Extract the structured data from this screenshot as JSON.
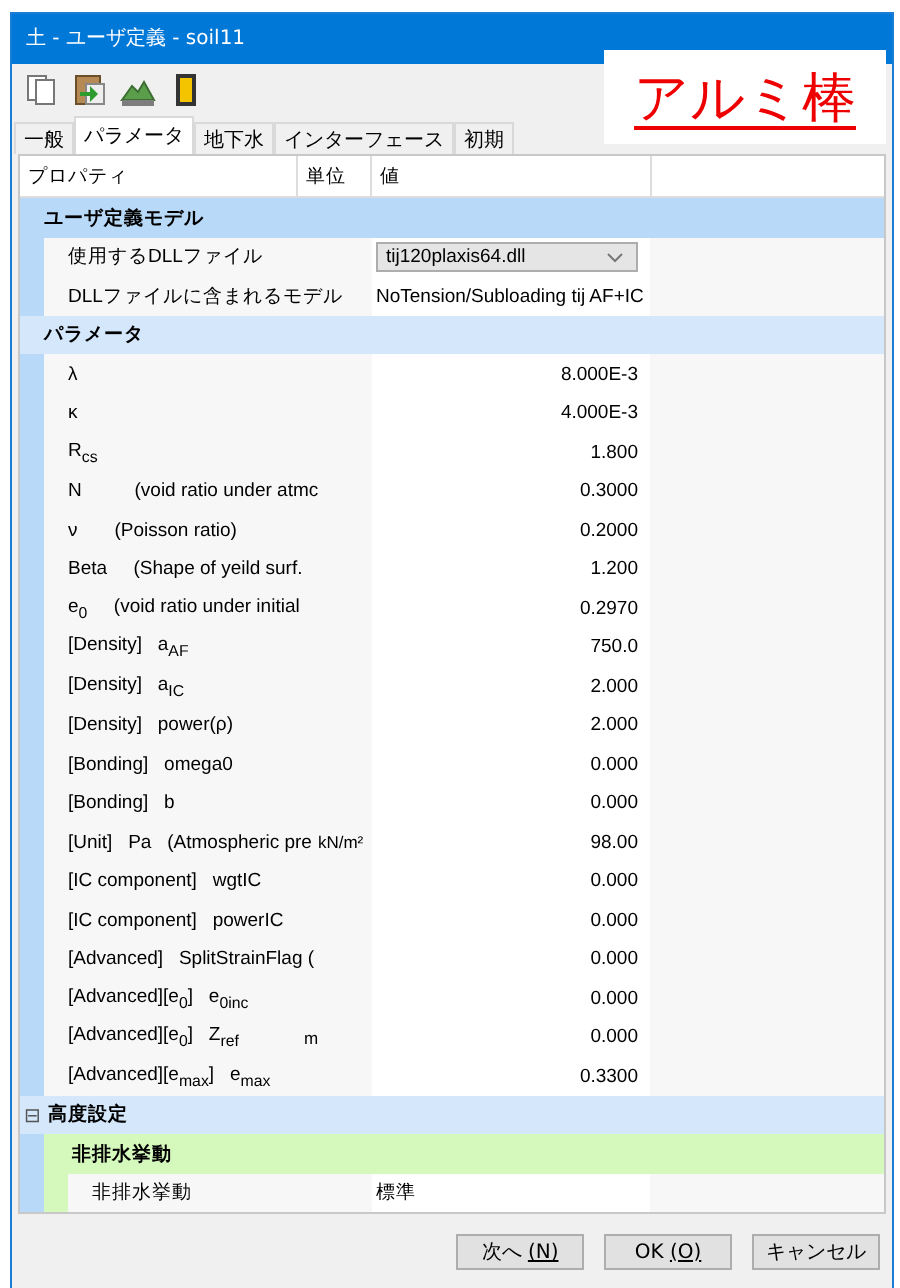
{
  "window": {
    "title": "土 - ユーザ定義 - soil11"
  },
  "annotation": {
    "text": "アルミ棒"
  },
  "tabs": [
    {
      "label": "一般",
      "selected": false
    },
    {
      "label": "パラメータ",
      "selected": true
    },
    {
      "label": "地下水",
      "selected": false
    },
    {
      "label": "インターフェース",
      "selected": false
    },
    {
      "label": "初期",
      "selected": false
    }
  ],
  "grid": {
    "columns": [
      "プロパティ",
      "単位",
      "値"
    ],
    "sections": [
      {
        "title": "ユーザ定義モデル",
        "selected": true,
        "rows": [
          {
            "kind": "dropdown",
            "label": "使用するDLLファイル",
            "value": "tij120plaxis64.dll"
          },
          {
            "kind": "text",
            "label": "DLLファイルに含まれるモデル",
            "value": "NoTension/Subloading tij AF+IC"
          }
        ]
      },
      {
        "title": "パラメータ",
        "selected": false,
        "rows": [
          {
            "kind": "number",
            "label": "λ",
            "value": "8.000E-3"
          },
          {
            "kind": "number",
            "label": "κ",
            "value": "4.000E-3"
          },
          {
            "kind": "number",
            "label": "R$_{cs}$",
            "value": "1.800"
          },
          {
            "kind": "number",
            "label": "N          (void ratio under atmc",
            "value": "0.3000"
          },
          {
            "kind": "number",
            "label": "ν       (Poisson ratio)",
            "value": "0.2000"
          },
          {
            "kind": "number",
            "label": "Beta     (Shape of yeild surf.",
            "value": "1.200"
          },
          {
            "kind": "number",
            "label": "e$_{0}$     (void ratio under initial",
            "value": "0.2970"
          },
          {
            "kind": "number",
            "label": "[Density]   a$_{AF}$",
            "value": "750.0"
          },
          {
            "kind": "number",
            "label": "[Density]   a$_{IC}$",
            "value": "2.000"
          },
          {
            "kind": "number",
            "label": "[Density]   power(ρ)",
            "value": "2.000"
          },
          {
            "kind": "number",
            "label": "[Bonding]   omega0",
            "value": "0.000"
          },
          {
            "kind": "number",
            "label": "[Bonding]   b",
            "value": "0.000"
          },
          {
            "kind": "number",
            "label": "[Unit]   Pa   (Atmospheric pre",
            "unit": "kN/m²",
            "value": "98.00"
          },
          {
            "kind": "number",
            "label": "[IC component]   wgtIC",
            "value": "0.000"
          },
          {
            "kind": "number",
            "label": "[IC component]   powerIC",
            "value": "0.000"
          },
          {
            "kind": "number",
            "label": "[Advanced]   SplitStrainFlag (",
            "value": "0.000"
          },
          {
            "kind": "number",
            "label": "[Advanced][e$_{0}$]   e$_{0inc}$",
            "value": "0.000"
          },
          {
            "kind": "number",
            "label": "[Advanced][e$_{0}$]   Z$_{ref}$",
            "unit": "m",
            "value": "0.000"
          },
          {
            "kind": "number",
            "label": "[Advanced][e$_{max}$]   e$_{max}$",
            "value": "0.3300"
          }
        ]
      },
      {
        "title": "高度設定",
        "selected": false,
        "toggle": "⊟",
        "subsections": [
          {
            "title": "非排水挙動",
            "rows": [
              {
                "kind": "text",
                "label": "非排水挙動",
                "value": "標準"
              }
            ]
          }
        ]
      }
    ]
  },
  "buttons": [
    {
      "label": "次へ ",
      "key": "(N)"
    },
    {
      "label": "OK ",
      "key": "(O)"
    },
    {
      "label": "キャンセル"
    }
  ]
}
